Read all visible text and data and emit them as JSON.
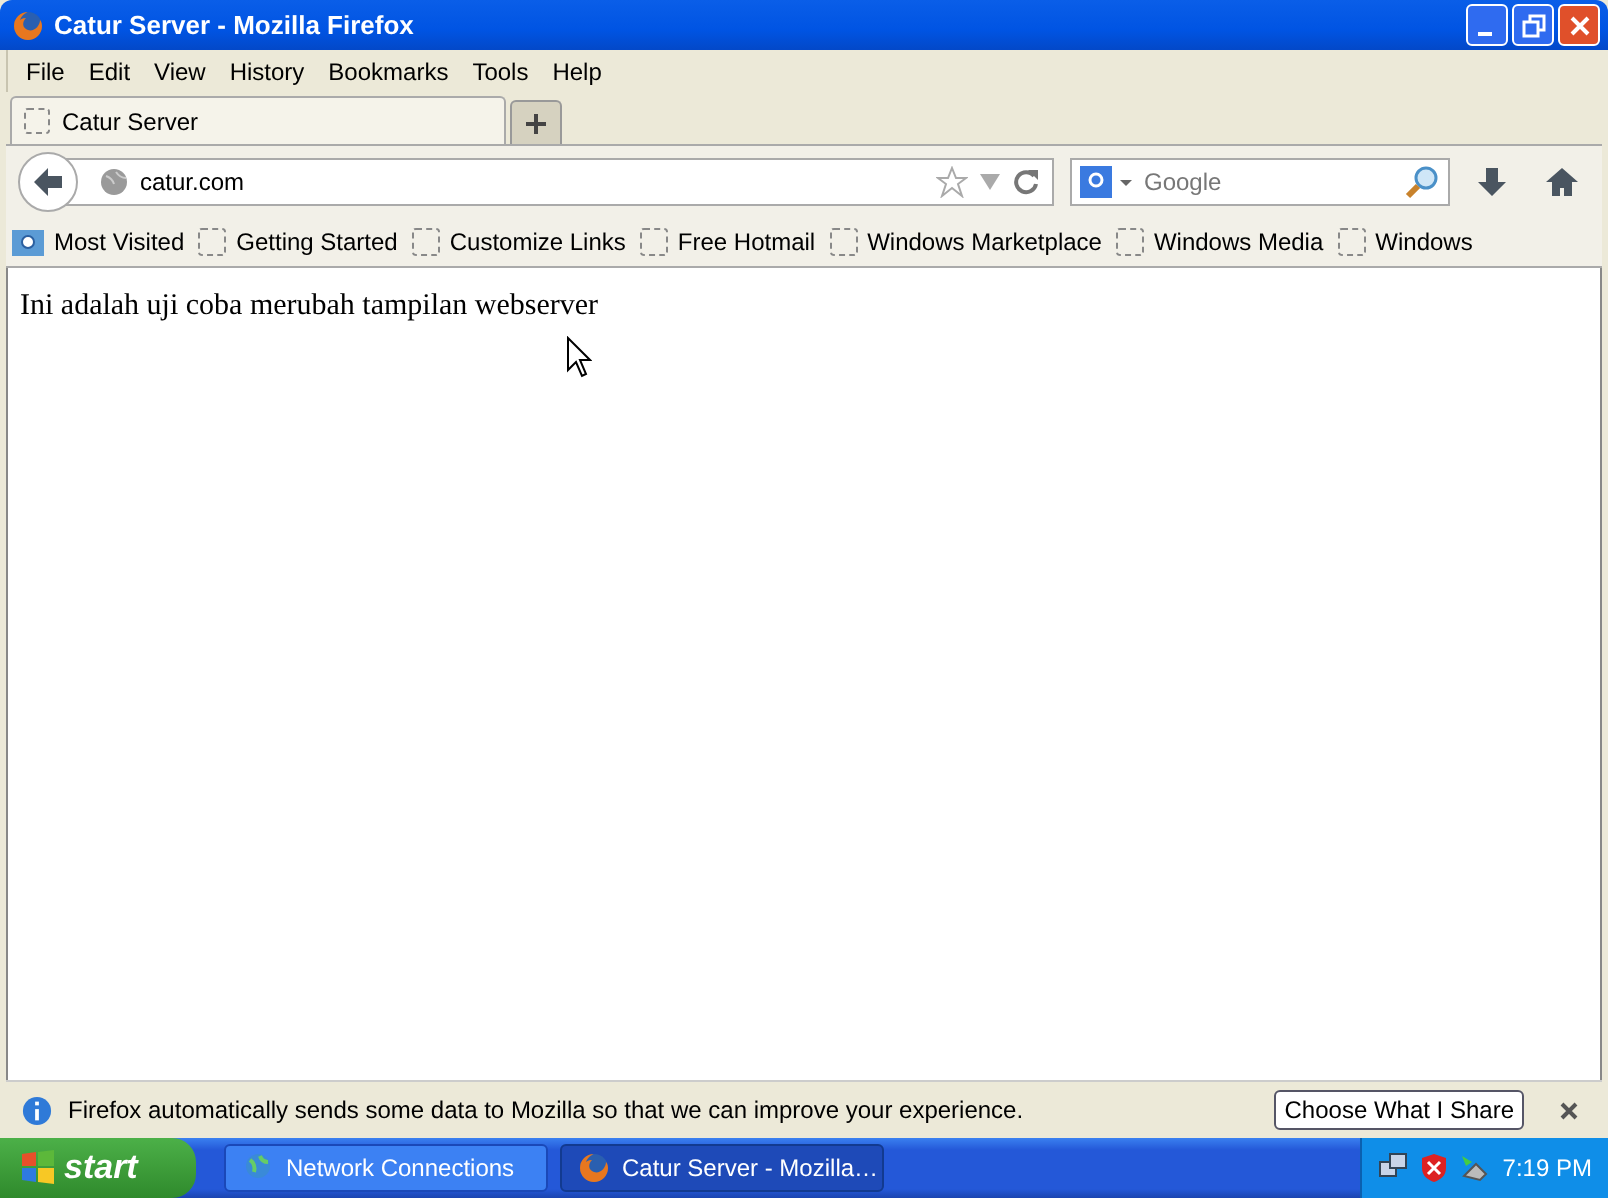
{
  "window": {
    "title": "Catur Server - Mozilla Firefox"
  },
  "menu": [
    "File",
    "Edit",
    "View",
    "History",
    "Bookmarks",
    "Tools",
    "Help"
  ],
  "tabs": [
    {
      "label": "Catur Server",
      "selected": true
    }
  ],
  "address": {
    "value": "catur.com"
  },
  "search": {
    "placeholder": "Google"
  },
  "bookmarks": [
    {
      "label": "Most Visited",
      "kind": "folder"
    },
    {
      "label": "Getting Started",
      "kind": "page"
    },
    {
      "label": "Customize Links",
      "kind": "page"
    },
    {
      "label": "Free Hotmail",
      "kind": "page"
    },
    {
      "label": "Windows Marketplace",
      "kind": "page"
    },
    {
      "label": "Windows Media",
      "kind": "page"
    },
    {
      "label": "Windows",
      "kind": "page"
    }
  ],
  "page": {
    "text": "Ini adalah uji coba merubah tampilan webserver"
  },
  "notification": {
    "message": "Firefox automatically sends some data to Mozilla so that we can improve your experience.",
    "button": "Choose What I Share"
  },
  "taskbar": {
    "start": "start",
    "items": [
      {
        "label": "Network Connections",
        "kind": "network",
        "selected": false
      },
      {
        "label": "Catur Server - Mozilla…",
        "kind": "firefox",
        "selected": true
      }
    ],
    "clock": "7:19 PM"
  }
}
